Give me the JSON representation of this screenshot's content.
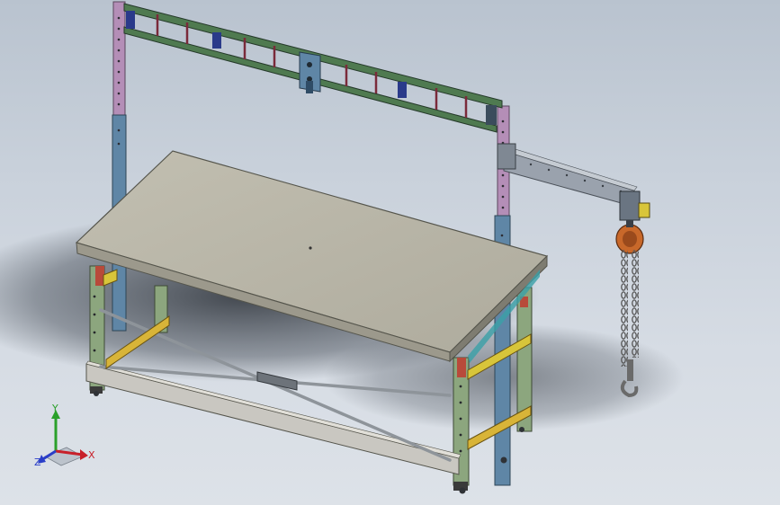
{
  "viewport": {
    "background_top": "#b9c3cf",
    "background_bottom": "#dde2e8"
  },
  "triad": {
    "x_label": "X",
    "y_label": "Y",
    "z_label": "Z",
    "x_color": "#c8202a",
    "y_color": "#2aa02a",
    "z_color": "#2a3ec8"
  },
  "model": {
    "table_top_color": "#b9b6a8",
    "frame_blue": "#5f86a6",
    "frame_green": "#8ca67e",
    "gantry_green": "#4f7a50",
    "gantry_pink": "#b48eb7",
    "brace_yellow": "#d8b438",
    "hoist_orange": "#c8682a",
    "chain_grey": "#6f6f6f"
  }
}
